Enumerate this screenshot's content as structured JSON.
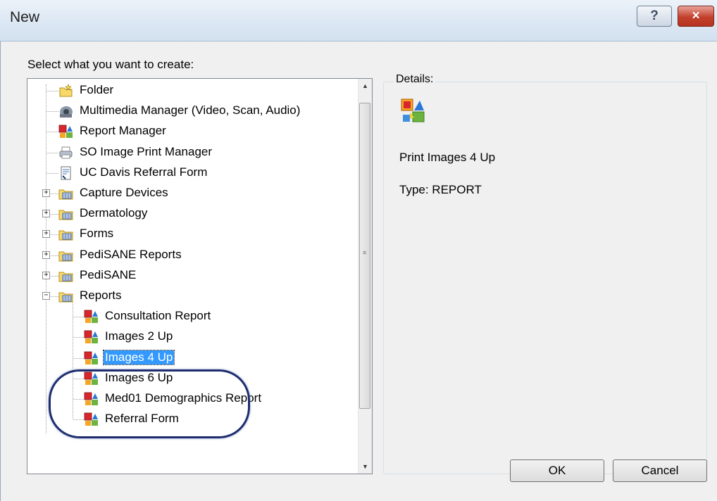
{
  "window": {
    "title": "New",
    "help_label": "?",
    "close_label": "×"
  },
  "prompt": "Select what you want to create:",
  "tree": {
    "items": [
      {
        "label": "Folder",
        "icon": "folder-star-icon",
        "level": 0,
        "expander": ""
      },
      {
        "label": "Multimedia Manager (Video, Scan, Audio)",
        "icon": "camera-icon",
        "level": 0,
        "expander": ""
      },
      {
        "label": "Report Manager",
        "icon": "report-icon",
        "level": 0,
        "expander": ""
      },
      {
        "label": "SO Image Print Manager",
        "icon": "printer-icon",
        "level": 0,
        "expander": ""
      },
      {
        "label": "UC Davis Referral Form",
        "icon": "form-icon",
        "level": 0,
        "expander": ""
      },
      {
        "label": "Capture Devices",
        "icon": "folder-grid-icon",
        "level": 0,
        "expander": "+"
      },
      {
        "label": "Dermatology",
        "icon": "folder-grid-icon",
        "level": 0,
        "expander": "+"
      },
      {
        "label": "Forms",
        "icon": "folder-grid-icon",
        "level": 0,
        "expander": "+"
      },
      {
        "label": "PediSANE Reports",
        "icon": "folder-grid-icon",
        "level": 0,
        "expander": "+"
      },
      {
        "label": "PediSANE",
        "icon": "folder-grid-icon",
        "level": 0,
        "expander": "+"
      },
      {
        "label": "Reports",
        "icon": "folder-grid-icon",
        "level": 0,
        "expander": "−"
      },
      {
        "label": "Consultation Report",
        "icon": "report-icon",
        "level": 1,
        "expander": ""
      },
      {
        "label": "Images 2 Up",
        "icon": "report-icon",
        "level": 1,
        "expander": ""
      },
      {
        "label": "Images 4 Up",
        "icon": "report-icon",
        "level": 1,
        "expander": "",
        "selected": true
      },
      {
        "label": "Images 6 Up",
        "icon": "report-icon",
        "level": 1,
        "expander": ""
      },
      {
        "label": "Med01 Demographics Report",
        "icon": "report-icon",
        "level": 1,
        "expander": ""
      },
      {
        "label": "Referral Form",
        "icon": "report-icon",
        "level": 1,
        "expander": ""
      }
    ]
  },
  "details": {
    "title": "Details:",
    "icon": "report-icon",
    "name": "Print Images 4 Up",
    "type": "Type: REPORT"
  },
  "buttons": {
    "ok": "OK",
    "cancel": "Cancel"
  },
  "scrollbar": {
    "up": "▲",
    "down": "▼",
    "grip": "≡"
  }
}
